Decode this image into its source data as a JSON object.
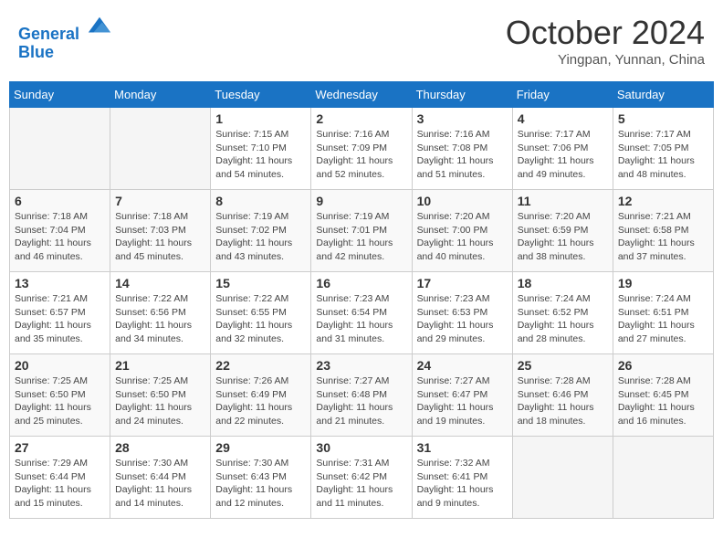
{
  "header": {
    "logo_line1": "General",
    "logo_line2": "Blue",
    "month_title": "October 2024",
    "location": "Yingpan, Yunnan, China"
  },
  "weekdays": [
    "Sunday",
    "Monday",
    "Tuesday",
    "Wednesday",
    "Thursday",
    "Friday",
    "Saturday"
  ],
  "weeks": [
    [
      {
        "day": "",
        "sunrise": "",
        "sunset": "",
        "daylight": "",
        "empty": true
      },
      {
        "day": "",
        "sunrise": "",
        "sunset": "",
        "daylight": "",
        "empty": true
      },
      {
        "day": "1",
        "sunrise": "Sunrise: 7:15 AM",
        "sunset": "Sunset: 7:10 PM",
        "daylight": "Daylight: 11 hours and 54 minutes.",
        "empty": false
      },
      {
        "day": "2",
        "sunrise": "Sunrise: 7:16 AM",
        "sunset": "Sunset: 7:09 PM",
        "daylight": "Daylight: 11 hours and 52 minutes.",
        "empty": false
      },
      {
        "day": "3",
        "sunrise": "Sunrise: 7:16 AM",
        "sunset": "Sunset: 7:08 PM",
        "daylight": "Daylight: 11 hours and 51 minutes.",
        "empty": false
      },
      {
        "day": "4",
        "sunrise": "Sunrise: 7:17 AM",
        "sunset": "Sunset: 7:06 PM",
        "daylight": "Daylight: 11 hours and 49 minutes.",
        "empty": false
      },
      {
        "day": "5",
        "sunrise": "Sunrise: 7:17 AM",
        "sunset": "Sunset: 7:05 PM",
        "daylight": "Daylight: 11 hours and 48 minutes.",
        "empty": false
      }
    ],
    [
      {
        "day": "6",
        "sunrise": "Sunrise: 7:18 AM",
        "sunset": "Sunset: 7:04 PM",
        "daylight": "Daylight: 11 hours and 46 minutes.",
        "empty": false
      },
      {
        "day": "7",
        "sunrise": "Sunrise: 7:18 AM",
        "sunset": "Sunset: 7:03 PM",
        "daylight": "Daylight: 11 hours and 45 minutes.",
        "empty": false
      },
      {
        "day": "8",
        "sunrise": "Sunrise: 7:19 AM",
        "sunset": "Sunset: 7:02 PM",
        "daylight": "Daylight: 11 hours and 43 minutes.",
        "empty": false
      },
      {
        "day": "9",
        "sunrise": "Sunrise: 7:19 AM",
        "sunset": "Sunset: 7:01 PM",
        "daylight": "Daylight: 11 hours and 42 minutes.",
        "empty": false
      },
      {
        "day": "10",
        "sunrise": "Sunrise: 7:20 AM",
        "sunset": "Sunset: 7:00 PM",
        "daylight": "Daylight: 11 hours and 40 minutes.",
        "empty": false
      },
      {
        "day": "11",
        "sunrise": "Sunrise: 7:20 AM",
        "sunset": "Sunset: 6:59 PM",
        "daylight": "Daylight: 11 hours and 38 minutes.",
        "empty": false
      },
      {
        "day": "12",
        "sunrise": "Sunrise: 7:21 AM",
        "sunset": "Sunset: 6:58 PM",
        "daylight": "Daylight: 11 hours and 37 minutes.",
        "empty": false
      }
    ],
    [
      {
        "day": "13",
        "sunrise": "Sunrise: 7:21 AM",
        "sunset": "Sunset: 6:57 PM",
        "daylight": "Daylight: 11 hours and 35 minutes.",
        "empty": false
      },
      {
        "day": "14",
        "sunrise": "Sunrise: 7:22 AM",
        "sunset": "Sunset: 6:56 PM",
        "daylight": "Daylight: 11 hours and 34 minutes.",
        "empty": false
      },
      {
        "day": "15",
        "sunrise": "Sunrise: 7:22 AM",
        "sunset": "Sunset: 6:55 PM",
        "daylight": "Daylight: 11 hours and 32 minutes.",
        "empty": false
      },
      {
        "day": "16",
        "sunrise": "Sunrise: 7:23 AM",
        "sunset": "Sunset: 6:54 PM",
        "daylight": "Daylight: 11 hours and 31 minutes.",
        "empty": false
      },
      {
        "day": "17",
        "sunrise": "Sunrise: 7:23 AM",
        "sunset": "Sunset: 6:53 PM",
        "daylight": "Daylight: 11 hours and 29 minutes.",
        "empty": false
      },
      {
        "day": "18",
        "sunrise": "Sunrise: 7:24 AM",
        "sunset": "Sunset: 6:52 PM",
        "daylight": "Daylight: 11 hours and 28 minutes.",
        "empty": false
      },
      {
        "day": "19",
        "sunrise": "Sunrise: 7:24 AM",
        "sunset": "Sunset: 6:51 PM",
        "daylight": "Daylight: 11 hours and 27 minutes.",
        "empty": false
      }
    ],
    [
      {
        "day": "20",
        "sunrise": "Sunrise: 7:25 AM",
        "sunset": "Sunset: 6:50 PM",
        "daylight": "Daylight: 11 hours and 25 minutes.",
        "empty": false
      },
      {
        "day": "21",
        "sunrise": "Sunrise: 7:25 AM",
        "sunset": "Sunset: 6:50 PM",
        "daylight": "Daylight: 11 hours and 24 minutes.",
        "empty": false
      },
      {
        "day": "22",
        "sunrise": "Sunrise: 7:26 AM",
        "sunset": "Sunset: 6:49 PM",
        "daylight": "Daylight: 11 hours and 22 minutes.",
        "empty": false
      },
      {
        "day": "23",
        "sunrise": "Sunrise: 7:27 AM",
        "sunset": "Sunset: 6:48 PM",
        "daylight": "Daylight: 11 hours and 21 minutes.",
        "empty": false
      },
      {
        "day": "24",
        "sunrise": "Sunrise: 7:27 AM",
        "sunset": "Sunset: 6:47 PM",
        "daylight": "Daylight: 11 hours and 19 minutes.",
        "empty": false
      },
      {
        "day": "25",
        "sunrise": "Sunrise: 7:28 AM",
        "sunset": "Sunset: 6:46 PM",
        "daylight": "Daylight: 11 hours and 18 minutes.",
        "empty": false
      },
      {
        "day": "26",
        "sunrise": "Sunrise: 7:28 AM",
        "sunset": "Sunset: 6:45 PM",
        "daylight": "Daylight: 11 hours and 16 minutes.",
        "empty": false
      }
    ],
    [
      {
        "day": "27",
        "sunrise": "Sunrise: 7:29 AM",
        "sunset": "Sunset: 6:44 PM",
        "daylight": "Daylight: 11 hours and 15 minutes.",
        "empty": false
      },
      {
        "day": "28",
        "sunrise": "Sunrise: 7:30 AM",
        "sunset": "Sunset: 6:44 PM",
        "daylight": "Daylight: 11 hours and 14 minutes.",
        "empty": false
      },
      {
        "day": "29",
        "sunrise": "Sunrise: 7:30 AM",
        "sunset": "Sunset: 6:43 PM",
        "daylight": "Daylight: 11 hours and 12 minutes.",
        "empty": false
      },
      {
        "day": "30",
        "sunrise": "Sunrise: 7:31 AM",
        "sunset": "Sunset: 6:42 PM",
        "daylight": "Daylight: 11 hours and 11 minutes.",
        "empty": false
      },
      {
        "day": "31",
        "sunrise": "Sunrise: 7:32 AM",
        "sunset": "Sunset: 6:41 PM",
        "daylight": "Daylight: 11 hours and 9 minutes.",
        "empty": false
      },
      {
        "day": "",
        "sunrise": "",
        "sunset": "",
        "daylight": "",
        "empty": true
      },
      {
        "day": "",
        "sunrise": "",
        "sunset": "",
        "daylight": "",
        "empty": true
      }
    ]
  ]
}
